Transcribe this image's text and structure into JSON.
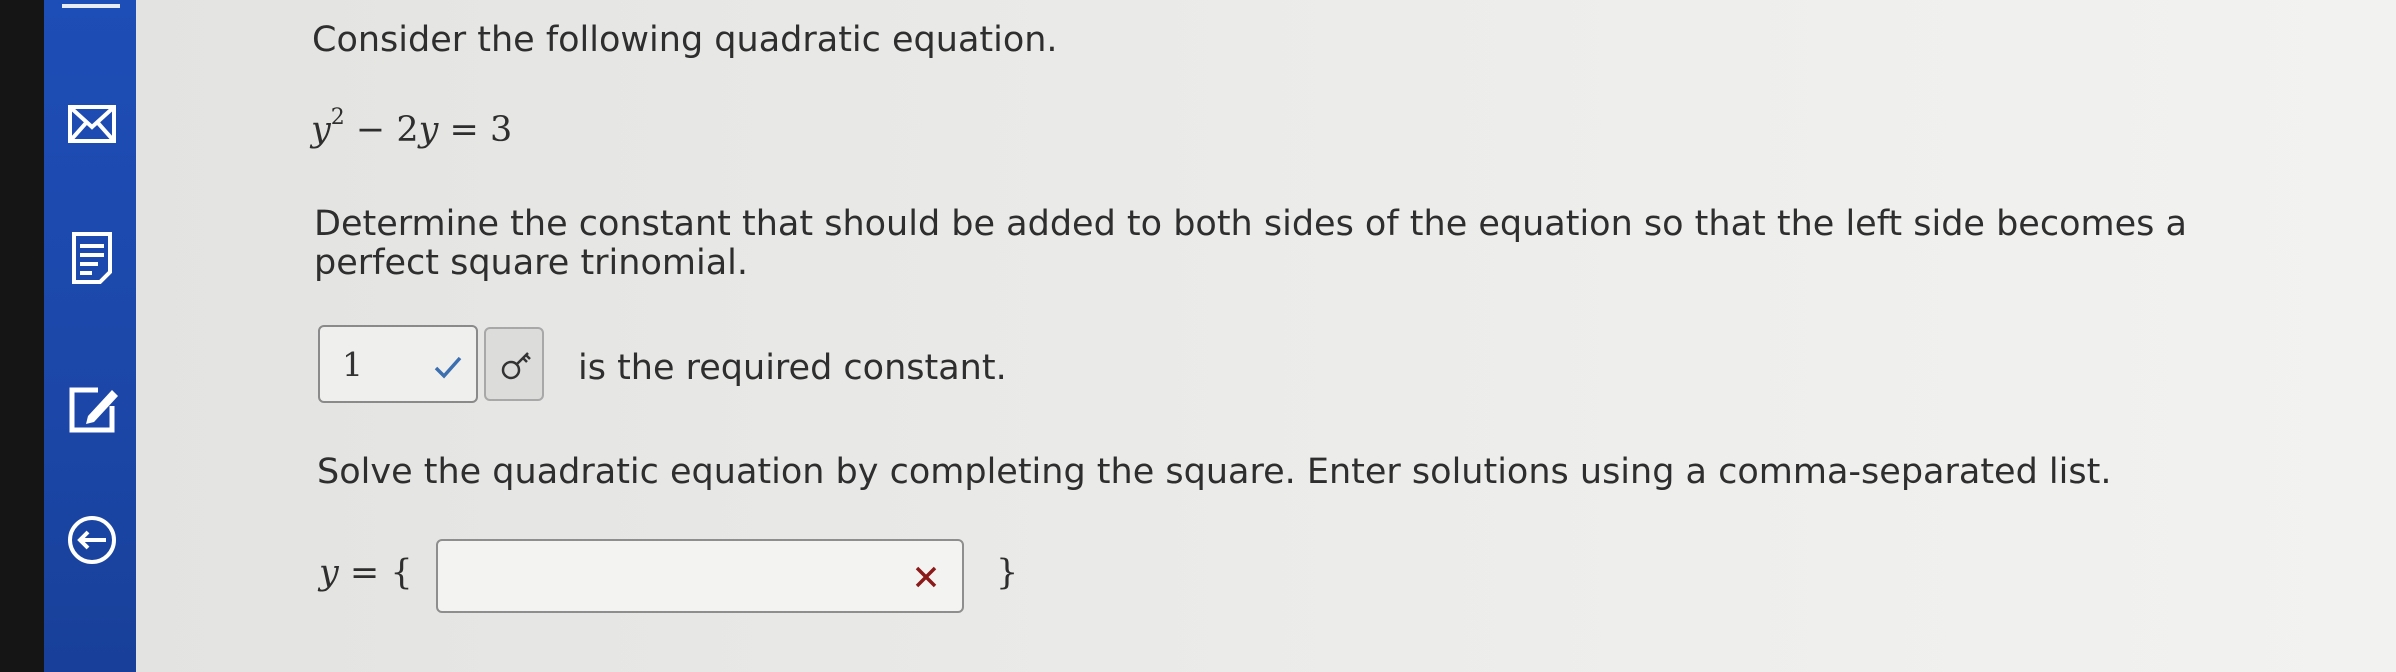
{
  "sidebar": {
    "icons": [
      "mail-icon",
      "notes-icon",
      "edit-icon",
      "exit-icon"
    ]
  },
  "question": {
    "intro": "Consider the following quadratic equation.",
    "equation": {
      "var": "y",
      "exp": "2",
      "rest": " − 2",
      "var2": "y",
      "rhs": " = 3"
    },
    "prompt_line1": "Determine the constant that should be added to both sides of the equation so that the left side becomes a",
    "prompt_line2": "perfect square trinomial.",
    "constant_answer": "1",
    "constant_status": "correct",
    "constant_suffix": "is the required constant.",
    "solve_prompt": "Solve the quadratic equation by completing the square. Enter solutions using a comma-separated list.",
    "solution_label_var": "y",
    "solution_label_rest": " = {",
    "solution_close": "}",
    "solution_value": "",
    "solution_status": "incorrect"
  },
  "colors": {
    "sidebar": "#1d4db6",
    "check": "#3c6fb0",
    "xmark": "#8b1a1a"
  }
}
